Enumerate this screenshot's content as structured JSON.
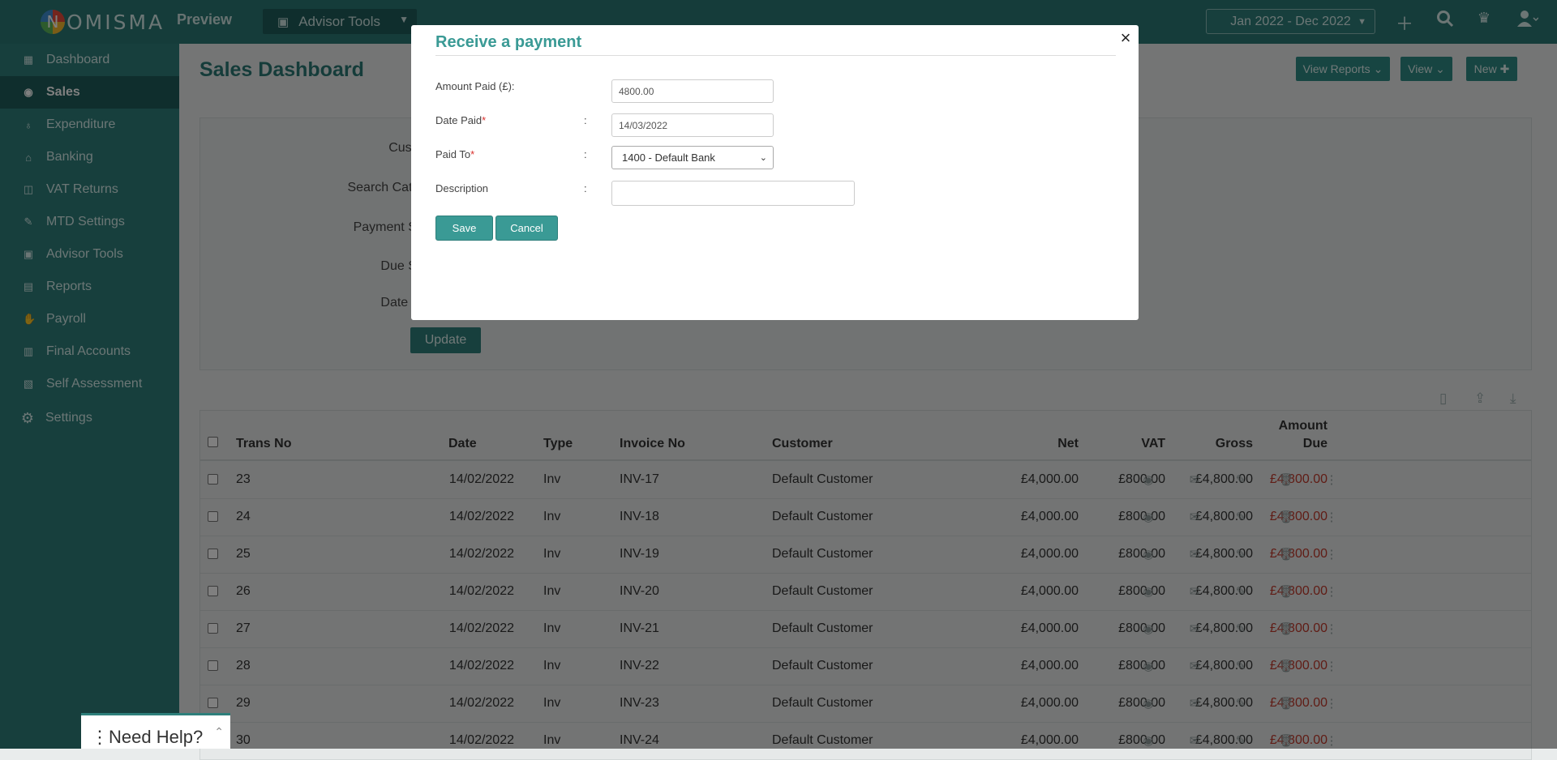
{
  "topbar": {
    "logo": "OMISMA",
    "logo_letter": "N",
    "preview": "Preview",
    "advisor_tools": "Advisor Tools",
    "date_range": "Jan 2022 - Dec 2022"
  },
  "sidebar": {
    "items": [
      {
        "label": "Dashboard",
        "icon": "dashboard-icon"
      },
      {
        "label": "Sales",
        "icon": "sales-icon"
      },
      {
        "label": "Expenditure",
        "icon": "expenditure-icon"
      },
      {
        "label": "Banking",
        "icon": "bank-icon"
      },
      {
        "label": "VAT Returns",
        "icon": "vat-icon"
      },
      {
        "label": "MTD Settings",
        "icon": "mtd-icon"
      },
      {
        "label": "Advisor Tools",
        "icon": "briefcase-icon"
      },
      {
        "label": "Reports",
        "icon": "reports-icon"
      },
      {
        "label": "Payroll",
        "icon": "payroll-icon"
      },
      {
        "label": "Final Accounts",
        "icon": "final-accounts-icon"
      },
      {
        "label": "Self Assessment",
        "icon": "self-assessment-icon"
      },
      {
        "label": "Settings",
        "icon": "gear-icon"
      }
    ]
  },
  "page": {
    "title": "Sales Dashboard",
    "view_reports": "View Reports",
    "view": "View",
    "new": "New"
  },
  "filters": {
    "customer": "Customer:",
    "search_category": "Search Category:",
    "payment_status": "Payment Status:",
    "due_status": "Due Status:",
    "date_range": "Date range:",
    "update": "Update"
  },
  "table": {
    "headers": {
      "trans_no": "Trans No",
      "date": "Date",
      "type": "Type",
      "invoice_no": "Invoice No",
      "customer": "Customer",
      "net": "Net",
      "vat": "VAT",
      "gross": "Gross",
      "amount": "Amount",
      "due": "Due"
    },
    "rows": [
      {
        "trans_no": "23",
        "date": "14/02/2022",
        "type": "Inv",
        "invoice_no": "INV-17",
        "customer": "Default Customer",
        "net": "£4,000.00",
        "vat": "£800.00",
        "gross": "£4,800.00",
        "due": "£4,800.00"
      },
      {
        "trans_no": "24",
        "date": "14/02/2022",
        "type": "Inv",
        "invoice_no": "INV-18",
        "customer": "Default Customer",
        "net": "£4,000.00",
        "vat": "£800.00",
        "gross": "£4,800.00",
        "due": "£4,800.00"
      },
      {
        "trans_no": "25",
        "date": "14/02/2022",
        "type": "Inv",
        "invoice_no": "INV-19",
        "customer": "Default Customer",
        "net": "£4,000.00",
        "vat": "£800.00",
        "gross": "£4,800.00",
        "due": "£4,800.00"
      },
      {
        "trans_no": "26",
        "date": "14/02/2022",
        "type": "Inv",
        "invoice_no": "INV-20",
        "customer": "Default Customer",
        "net": "£4,000.00",
        "vat": "£800.00",
        "gross": "£4,800.00",
        "due": "£4,800.00"
      },
      {
        "trans_no": "27",
        "date": "14/02/2022",
        "type": "Inv",
        "invoice_no": "INV-21",
        "customer": "Default Customer",
        "net": "£4,000.00",
        "vat": "£800.00",
        "gross": "£4,800.00",
        "due": "£4,800.00"
      },
      {
        "trans_no": "28",
        "date": "14/02/2022",
        "type": "Inv",
        "invoice_no": "INV-22",
        "customer": "Default Customer",
        "net": "£4,000.00",
        "vat": "£800.00",
        "gross": "£4,800.00",
        "due": "£4,800.00"
      },
      {
        "trans_no": "29",
        "date": "14/02/2022",
        "type": "Inv",
        "invoice_no": "INV-23",
        "customer": "Default Customer",
        "net": "£4,000.00",
        "vat": "£800.00",
        "gross": "£4,800.00",
        "due": "£4,800.00"
      },
      {
        "trans_no": "30",
        "date": "14/02/2022",
        "type": "Inv",
        "invoice_no": "INV-24",
        "customer": "Default Customer",
        "net": "£4,000.00",
        "vat": "£800.00",
        "gross": "£4,800.00",
        "due": "£4,800.00"
      }
    ],
    "row_icons": [
      "eye-icon",
      "envelope-icon",
      "pencil-icon",
      "trash-icon",
      "kebab-menu-icon"
    ]
  },
  "modal": {
    "title": "Receive a payment",
    "amount_label": "Amount Paid (£):",
    "amount_value": "4800.00",
    "date_label": "Date Paid",
    "date_value": "14/03/2022",
    "paid_to_label": "Paid To",
    "paid_to_value": "1400 - Default Bank",
    "description_label": "Description",
    "description_value": "",
    "colon": ":",
    "required_mark": "*",
    "save": "Save",
    "cancel": "Cancel",
    "close": "×"
  },
  "help": {
    "label": "Need Help?"
  },
  "colors": {
    "brand": "#2a7975",
    "sidebar": "#2e7f7b",
    "accent": "#3a9a95",
    "due": "#c0392b"
  }
}
